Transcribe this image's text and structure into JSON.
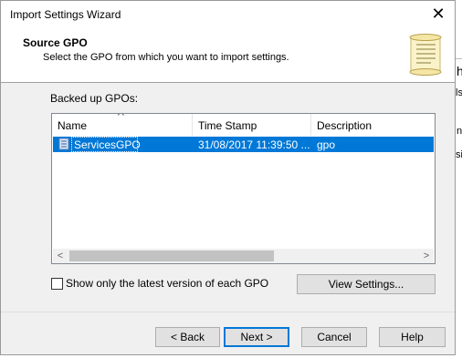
{
  "window": {
    "title": "Import Settings Wizard"
  },
  "header": {
    "title": "Source GPO",
    "subtitle": "Select the GPO from which you want to import settings."
  },
  "list": {
    "label": "Backed up GPOs:",
    "columns": [
      "Name",
      "Time Stamp",
      "Description"
    ],
    "rows": [
      {
        "name": "ServicesGPO",
        "time_stamp": "31/08/2017 11:39:50 ...",
        "description": "gpo"
      }
    ],
    "selected_row_color": "#0078d7"
  },
  "options": {
    "latest_version_label": "Show only the latest version of each GPO",
    "latest_version_checked": false,
    "view_settings_label": "View Settings..."
  },
  "footer": {
    "back_label": "< Back",
    "next_label": "Next >",
    "cancel_label": "Cancel",
    "help_label": "Help"
  },
  "background": {
    "fragments": [
      "h",
      "ls",
      "n",
      "si"
    ]
  },
  "icons": {
    "close": "close-icon",
    "header": "scroll-icon",
    "gpo": "gpo-icon",
    "sort": "sort-up-icon"
  },
  "colors": {
    "accent": "#0078d7",
    "dialog_bg": "#f0f0f0"
  }
}
